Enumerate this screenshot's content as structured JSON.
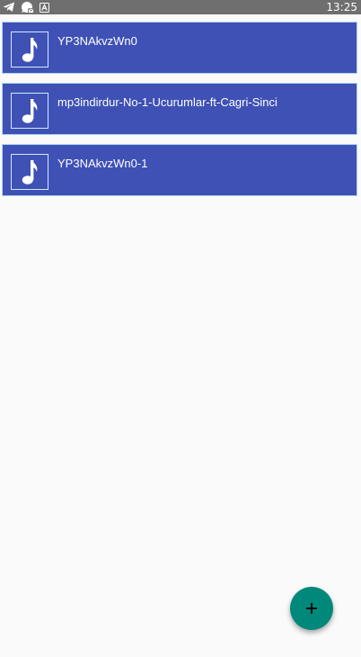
{
  "status_bar": {
    "time": "13:25",
    "icons": [
      "telegram-icon",
      "whatsapp-business-icon",
      "app-a-icon"
    ]
  },
  "tracks": [
    {
      "title": "YP3NAkvzWn0",
      "icon": "music-note-icon"
    },
    {
      "title": "mp3indirdur-No-1-Ucurumlar-ft-Cagri-Sinci",
      "icon": "music-note-icon"
    },
    {
      "title": "YP3NAkvzWn0-1",
      "icon": "music-note-icon"
    }
  ],
  "fab": {
    "label": "+",
    "icon": "plus-icon"
  },
  "colors": {
    "status_bar": "#6f6f6f",
    "item_background": "#3f51b5",
    "item_border": "#a9d9f2",
    "fab": "#00897b",
    "background": "#fafafa"
  }
}
